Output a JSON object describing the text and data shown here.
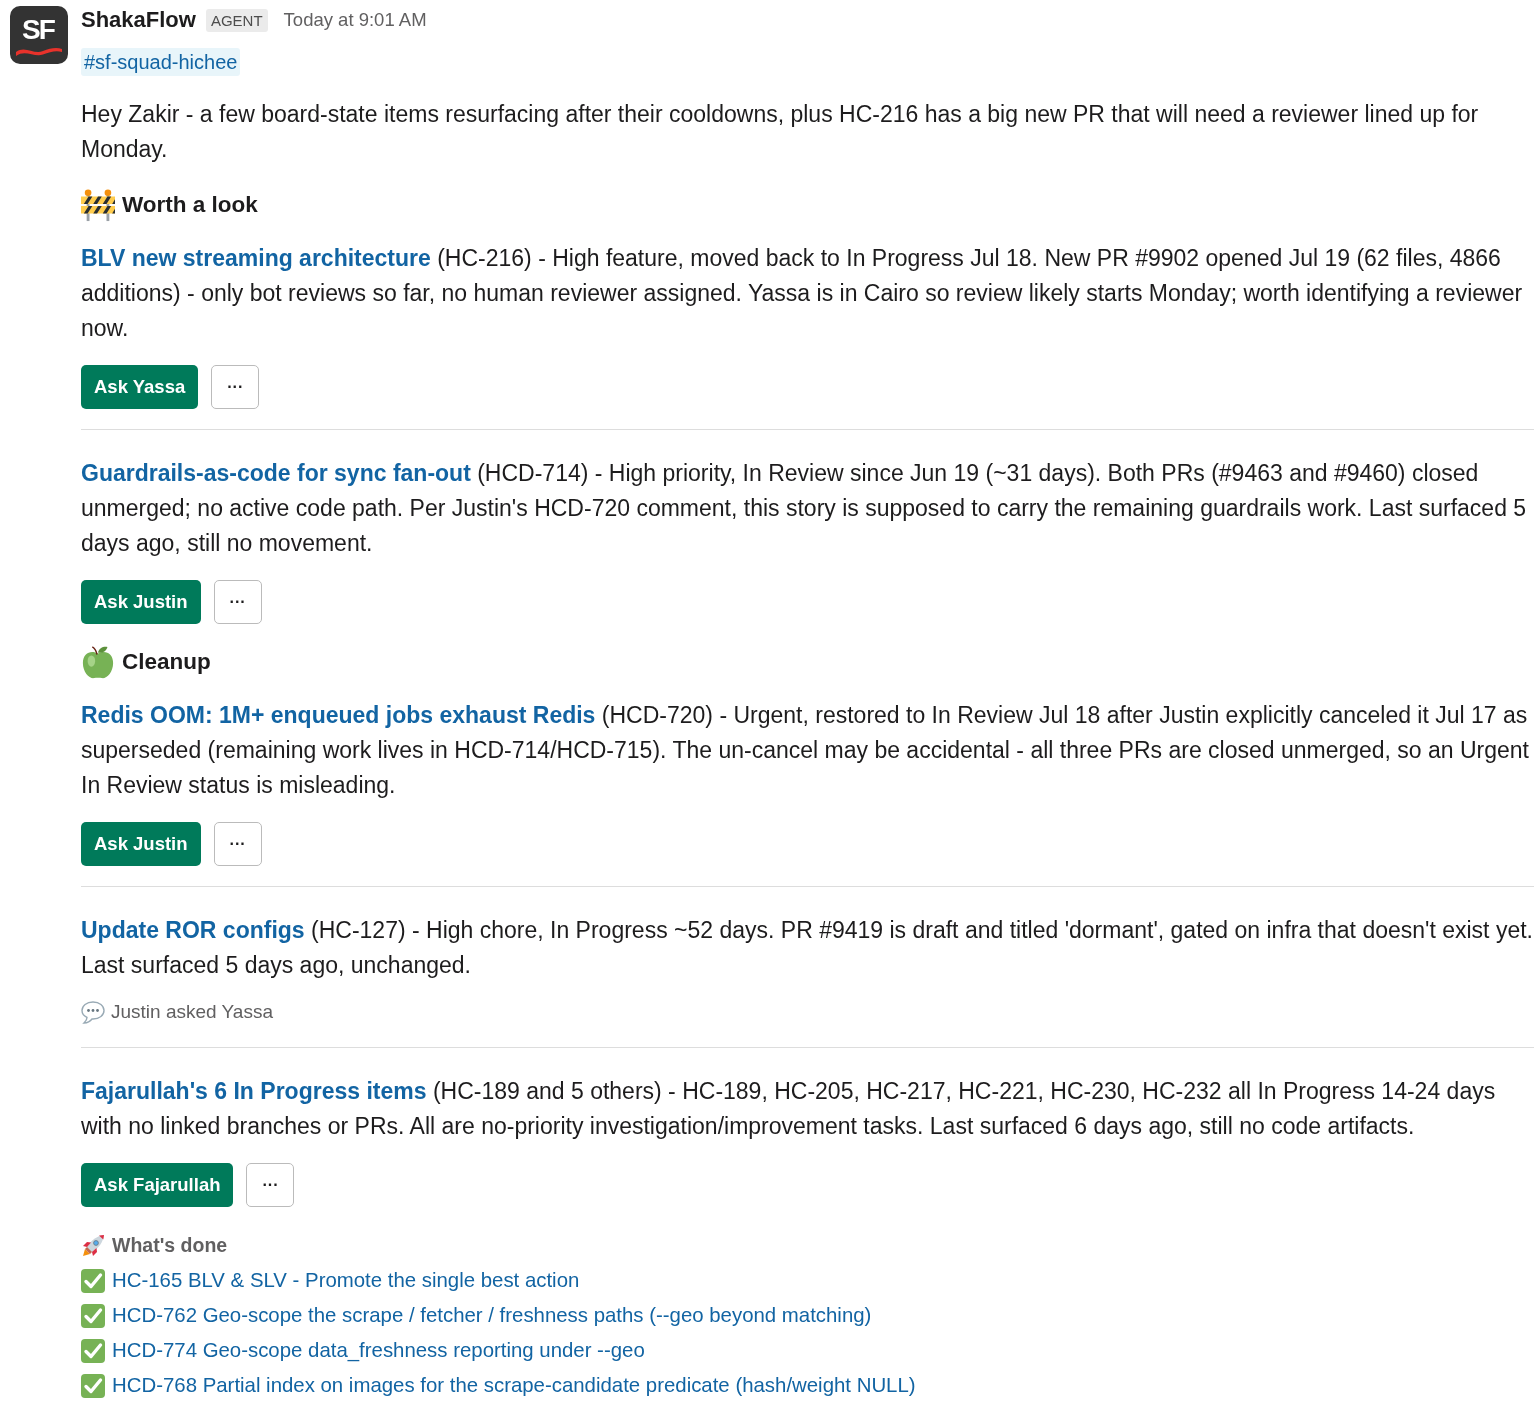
{
  "message": {
    "logo_text": "SF",
    "sender": "ShakaFlow",
    "badge": "AGENT",
    "timestamp": "Today at 9:01 AM",
    "channel": "#sf-squad-hichee",
    "intro": "Hey Zakir - a few board-state items resurfacing after their cooldowns, plus HC-216 has a big new PR that will need a reviewer lined up for Monday."
  },
  "sections": [
    {
      "kind": "attention",
      "title": "Worth a look",
      "items": [
        {
          "link": "BLV new streaming architecture",
          "text": "(HC-216) - High feature, moved back to In Progress Jul 18. New PR #9902 opened Jul 19 (62 files, 4866 additions) - only bot reviews so far, no human reviewer assigned. Yassa is in Cairo so review likely starts Monday; worth identifying a reviewer now.",
          "actions": [
            "Ask Yassa"
          ],
          "more": "···"
        },
        {
          "link": "Guardrails-as-code for sync fan-out",
          "text": "(HCD-714) - High priority, In Review since Jun 19 (~31 days). Both PRs (#9463 and #9460) closed unmerged; no active code path. Per Justin's HCD-720 comment, this story is supposed to carry the remaining guardrails work. Last surfaced 5 days ago, still no movement.",
          "actions": [
            "Ask Justin"
          ],
          "more": "···"
        }
      ]
    },
    {
      "kind": "cleanup",
      "title": "Cleanup",
      "items": [
        {
          "link": "Redis OOM: 1M+ enqueued jobs exhaust Redis",
          "text": "(HCD-720) - Urgent, restored to In Review Jul 18 after Justin explicitly canceled it Jul 17 as superseded (remaining work lives in HCD-714/HCD-715). The un-cancel may be accidental - all three PRs are closed unmerged, so an Urgent In Review status is misleading.",
          "actions": [
            "Ask Justin"
          ],
          "more": "···"
        },
        {
          "link": "Update ROR configs",
          "text": "(HC-127) - High chore, In Progress ~52 days. PR #9419 is draft and titled 'dormant', gated on infra that doesn't exist yet. Last surfaced 5 days ago, unchanged.",
          "note": "Justin asked Yassa"
        },
        {
          "link": "Fajarullah's 6 In Progress items",
          "text": "(HC-189 and 5 others) - HC-189, HC-205, HC-217, HC-221, HC-230, HC-232 all In Progress 14-24 days with no linked branches or PRs. All are no-priority investigation/improvement tasks. Last surfaced 6 days ago, still no code artifacts.",
          "actions": [
            "Ask Fajarullah"
          ],
          "more": "···"
        }
      ]
    }
  ],
  "done": {
    "title": "What's done",
    "items": [
      "HC-165 BLV & SLV - Promote the single best action",
      "HCD-762 Geo-scope the scrape / fetcher / freshness paths (--geo beyond matching)",
      "HCD-774 Geo-scope data_freshness reporting under --geo",
      "HCD-768 Partial index on images for the scrape-candidate predicate (hash/weight NULL)"
    ]
  }
}
